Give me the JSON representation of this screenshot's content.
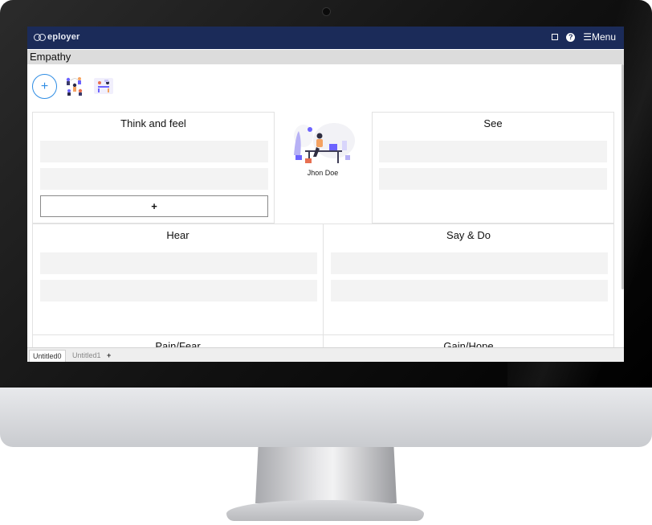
{
  "app": {
    "logo_text": "eployer",
    "menu_label": "☰Menu"
  },
  "page": {
    "title": "Empathy"
  },
  "toolbar": {
    "add_label": "+"
  },
  "persona": {
    "name": "Jhon Doe"
  },
  "sections": {
    "think_feel": {
      "title": "Think and feel",
      "add_label": "+"
    },
    "see": {
      "title": "See"
    },
    "hear": {
      "title": "Hear"
    },
    "say_do": {
      "title": "Say & Do"
    },
    "pain_fear": {
      "title": "Pain/Fear"
    },
    "gain_hope": {
      "title": "Gain/Hope"
    }
  },
  "tabs": [
    {
      "label": "Untitled0",
      "active": true
    },
    {
      "label": "Untitled1",
      "active": false
    }
  ],
  "tab_add_label": "+",
  "colors": {
    "topbar": "#1b2b59",
    "accent": "#2f8de4",
    "entry_bg": "#f3f3f3"
  }
}
